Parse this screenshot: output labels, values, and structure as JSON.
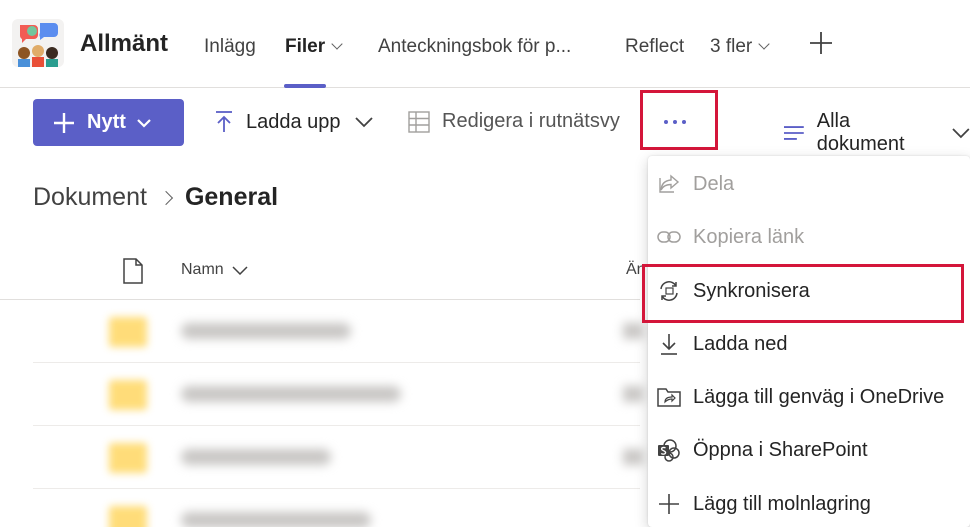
{
  "header": {
    "team_name": "Allmänt",
    "tabs": [
      {
        "label": "Inlägg"
      },
      {
        "label": "Filer"
      },
      {
        "label": "Anteckningsbok för p..."
      },
      {
        "label": "Reflect"
      },
      {
        "label": "3 fler"
      }
    ]
  },
  "toolbar": {
    "new_label": "Nytt",
    "upload_label": "Ladda upp",
    "grid_edit_label": "Redigera i rutnätsvy",
    "view_label": "Alla dokument"
  },
  "breadcrumb": {
    "root": "Dokument",
    "current": "General"
  },
  "table": {
    "col_name": "Namn",
    "col_modified": "Än"
  },
  "menu": {
    "items": [
      {
        "label": "Dela",
        "icon": "share-icon",
        "enabled": false
      },
      {
        "label": "Kopiera länk",
        "icon": "link-icon",
        "enabled": false
      },
      {
        "label": "Synkronisera",
        "icon": "sync-icon",
        "enabled": true
      },
      {
        "label": "Ladda ned",
        "icon": "download-icon",
        "enabled": true
      },
      {
        "label": "Lägga till genväg i OneDrive",
        "icon": "shortcut-icon",
        "enabled": true
      },
      {
        "label": "Öppna i SharePoint",
        "icon": "sharepoint-icon",
        "enabled": true
      },
      {
        "label": "Lägg till molnlagring",
        "icon": "plus-icon",
        "enabled": true
      }
    ]
  },
  "colors": {
    "accent": "#5b5fc7",
    "highlight": "#d4163a"
  }
}
